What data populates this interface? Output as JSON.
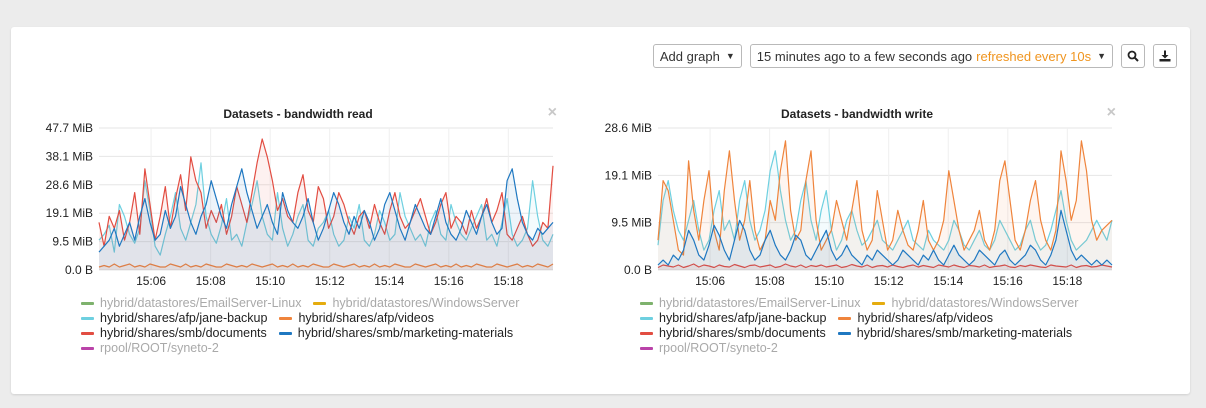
{
  "toolbar": {
    "add_graph_label": "Add graph",
    "time_range_label": "15 minutes ago to a few seconds ago",
    "refresh_label": "refreshed every 10s",
    "zoom_icon": "search-icon",
    "download_icon": "download-icon"
  },
  "chart_data": [
    {
      "type": "area",
      "title": "Datasets - bandwidth read",
      "close_label": "×",
      "y_unit": "MiB",
      "ylim": [
        0,
        47.7
      ],
      "y_ticks": [
        "0.0 B",
        "9.5 MiB",
        "19.1 MiB",
        "28.6 MiB",
        "38.1 MiB",
        "47.7 MiB"
      ],
      "x_ticks": [
        "15:06",
        "15:08",
        "15:10",
        "15:12",
        "15:14",
        "15:16",
        "15:18"
      ],
      "xlim": [
        "15:04:15",
        "15:19:30"
      ],
      "series": [
        {
          "name": "hybrid/datastores/EmailServer-Linux",
          "color": "#7eb26d",
          "hidden": true
        },
        {
          "name": "hybrid/datastores/WindowsServer",
          "color": "#e5ac0e",
          "hidden": true
        },
        {
          "name": "hybrid/shares/afp/jane-backup",
          "color": "#6ed0e0",
          "hidden": false,
          "values": [
            10,
            12,
            15,
            6,
            22,
            18,
            12,
            9,
            14,
            30,
            20,
            8,
            5,
            12,
            18,
            26,
            14,
            10,
            16,
            22,
            36,
            18,
            12,
            9,
            15,
            24,
            10,
            12,
            8,
            16,
            22,
            30,
            18,
            12,
            10,
            26,
            14,
            8,
            12,
            18,
            22,
            10,
            8,
            14,
            16,
            20,
            12,
            8,
            10,
            18,
            14,
            22,
            10,
            8,
            12,
            20,
            16,
            10,
            12,
            26,
            18,
            14,
            10,
            12,
            8,
            16,
            20,
            12,
            10,
            22,
            16,
            12,
            10,
            14,
            18,
            22,
            10,
            12,
            8,
            16,
            24,
            12,
            8,
            10,
            14,
            30,
            18,
            10,
            8,
            12
          ]
        },
        {
          "name": "hybrid/shares/afp/videos",
          "color": "#ef843c",
          "hidden": false,
          "values": [
            1,
            1.5,
            1,
            2,
            1,
            1.5,
            2,
            1,
            1.5,
            1,
            2,
            1.5,
            1,
            1,
            2,
            1.5,
            1,
            2,
            1,
            1.5,
            1,
            2,
            1.5,
            1,
            1,
            2,
            1.5,
            1,
            1.5,
            1,
            2,
            1.5,
            1,
            1.5,
            2,
            1,
            1.5,
            1,
            2,
            1,
            1.5,
            1,
            2,
            1.5,
            1,
            1,
            2,
            1.5,
            1,
            1.5,
            2,
            1,
            1.5,
            1,
            2,
            1,
            1.5,
            1,
            2,
            1.5,
            1,
            1,
            2,
            1.5,
            1,
            1.5,
            2,
            1,
            1.5,
            1,
            2,
            1,
            1.5,
            1,
            2,
            1.5,
            1,
            1,
            2,
            1.5,
            1,
            1.5,
            2,
            1,
            1.5,
            1,
            2,
            1.5,
            1,
            2
          ]
        },
        {
          "name": "hybrid/shares/smb/documents",
          "color": "#e24d42",
          "hidden": false,
          "values": [
            16,
            8,
            18,
            14,
            20,
            10,
            16,
            26,
            12,
            34,
            22,
            10,
            18,
            28,
            14,
            24,
            32,
            20,
            38,
            30,
            26,
            14,
            20,
            16,
            22,
            12,
            18,
            28,
            22,
            16,
            26,
            36,
            44,
            38,
            30,
            20,
            24,
            18,
            16,
            26,
            32,
            20,
            16,
            28,
            24,
            14,
            18,
            26,
            22,
            16,
            12,
            18,
            20,
            14,
            22,
            16,
            12,
            20,
            26,
            18,
            14,
            16,
            20,
            24,
            18,
            12,
            16,
            22,
            26,
            14,
            18,
            16,
            12,
            20,
            14,
            18,
            24,
            16,
            20,
            26,
            12,
            10,
            14,
            18,
            12,
            8,
            10,
            16,
            14,
            35
          ]
        },
        {
          "name": "hybrid/shares/smb/marketing-materials",
          "color": "#1f78c1",
          "hidden": false,
          "values": [
            6,
            8,
            10,
            14,
            8,
            12,
            16,
            10,
            18,
            24,
            16,
            10,
            12,
            20,
            14,
            18,
            28,
            22,
            16,
            12,
            18,
            22,
            30,
            24,
            18,
            14,
            22,
            28,
            34,
            26,
            20,
            14,
            18,
            22,
            16,
            12,
            26,
            20,
            16,
            14,
            18,
            24,
            16,
            10,
            14,
            20,
            26,
            22,
            16,
            12,
            18,
            14,
            20,
            16,
            10,
            14,
            22,
            26,
            20,
            14,
            10,
            16,
            22,
            18,
            14,
            12,
            18,
            24,
            16,
            12,
            10,
            14,
            20,
            16,
            12,
            18,
            22,
            16,
            12,
            14,
            30,
            34,
            24,
            16,
            12,
            10,
            14,
            12,
            14,
            16
          ]
        },
        {
          "name": "rpool/ROOT/syneto-2",
          "color": "#ba43a9",
          "hidden": true
        }
      ]
    },
    {
      "type": "area",
      "title": "Datasets - bandwidth write",
      "close_label": "×",
      "y_unit": "MiB",
      "ylim": [
        0,
        28.6
      ],
      "y_ticks": [
        "0.0 B",
        "9.5 MiB",
        "19.1 MiB",
        "28.6 MiB"
      ],
      "x_ticks": [
        "15:06",
        "15:08",
        "15:10",
        "15:12",
        "15:14",
        "15:16",
        "15:18"
      ],
      "xlim": [
        "15:04:15",
        "15:19:30"
      ],
      "series": [
        {
          "name": "hybrid/datastores/EmailServer-Linux",
          "color": "#7eb26d",
          "hidden": true
        },
        {
          "name": "hybrid/datastores/WindowsServer",
          "color": "#e5ac0e",
          "hidden": true
        },
        {
          "name": "hybrid/shares/afp/jane-backup",
          "color": "#6ed0e0",
          "hidden": false,
          "values": [
            5,
            14,
            18,
            12,
            8,
            6,
            10,
            14,
            8,
            4,
            6,
            12,
            16,
            8,
            10,
            6,
            14,
            18,
            10,
            6,
            8,
            12,
            20,
            24,
            16,
            10,
            6,
            8,
            14,
            18,
            10,
            6,
            12,
            16,
            8,
            4,
            6,
            10,
            12,
            8,
            5,
            6,
            8,
            10,
            6,
            5,
            4,
            6,
            8,
            10,
            6,
            5,
            4,
            8,
            6,
            5,
            4,
            6,
            10,
            8,
            5,
            4,
            6,
            8,
            5,
            4,
            6,
            10,
            8,
            6,
            4,
            5,
            8,
            10,
            6,
            4,
            5,
            8,
            12,
            16,
            10,
            6,
            4,
            5,
            6,
            8,
            10,
            8,
            6,
            10
          ]
        },
        {
          "name": "hybrid/shares/afp/videos",
          "color": "#ef843c",
          "hidden": false,
          "values": [
            6,
            18,
            16,
            10,
            4,
            3,
            22,
            12,
            6,
            14,
            20,
            8,
            4,
            16,
            24,
            14,
            6,
            10,
            18,
            8,
            4,
            6,
            14,
            10,
            20,
            26,
            12,
            6,
            8,
            18,
            24,
            10,
            4,
            6,
            8,
            14,
            10,
            6,
            12,
            18,
            8,
            4,
            6,
            16,
            10,
            4,
            6,
            12,
            8,
            5,
            4,
            8,
            14,
            6,
            4,
            6,
            10,
            20,
            14,
            8,
            4,
            6,
            8,
            12,
            6,
            4,
            8,
            18,
            22,
            14,
            6,
            4,
            8,
            14,
            18,
            10,
            6,
            4,
            8,
            24,
            18,
            10,
            14,
            26,
            20,
            10,
            6,
            8,
            9,
            10
          ]
        },
        {
          "name": "hybrid/shares/smb/documents",
          "color": "#e24d42",
          "hidden": false,
          "values": [
            0.5,
            1,
            0.8,
            0.6,
            1,
            0.5,
            0.8,
            1.2,
            0.6,
            1,
            0.8,
            0.5,
            1,
            0.7,
            0.6,
            1.1,
            0.8,
            0.5,
            0.9,
            1,
            0.6,
            0.8,
            1,
            0.5,
            0.7,
            1.2,
            0.8,
            0.6,
            1,
            0.5,
            0.9,
            0.7,
            1,
            0.6,
            0.8,
            1,
            0.5,
            0.7,
            1.1,
            0.8,
            0.6,
            1,
            0.5,
            0.8,
            0.9,
            0.6,
            1,
            0.7,
            0.5,
            0.8,
            1,
            0.6,
            0.9,
            0.7,
            0.5,
            1,
            0.8,
            0.6,
            1,
            0.7,
            0.5,
            0.9,
            0.8,
            0.6,
            1,
            0.5,
            0.7,
            0.8,
            1,
            0.6,
            0.5,
            0.9,
            0.7,
            1,
            0.8,
            0.6,
            0.5,
            1,
            0.8,
            0.7,
            0.6,
            1,
            0.5,
            0.8,
            0.9,
            0.6,
            0.7,
            1,
            0.8,
            0.6
          ]
        },
        {
          "name": "hybrid/shares/smb/marketing-materials",
          "color": "#1f78c1",
          "hidden": false,
          "values": [
            1,
            2,
            1,
            3,
            2,
            4,
            8,
            6,
            3,
            2,
            5,
            9,
            7,
            4,
            2,
            6,
            10,
            8,
            4,
            2,
            3,
            6,
            8,
            5,
            3,
            2,
            4,
            7,
            6,
            3,
            2,
            4,
            6,
            8,
            4,
            2,
            3,
            5,
            3,
            2,
            1,
            3,
            2,
            4,
            3,
            2,
            1,
            2,
            4,
            3,
            2,
            1,
            3,
            2,
            4,
            2,
            1,
            3,
            5,
            3,
            2,
            1,
            2,
            4,
            3,
            2,
            1,
            3,
            4,
            2,
            1,
            2,
            3,
            5,
            4,
            2,
            1,
            3,
            6,
            12,
            8,
            4,
            2,
            3,
            2,
            1,
            2,
            1,
            2,
            1
          ]
        },
        {
          "name": "rpool/ROOT/syneto-2",
          "color": "#ba43a9",
          "hidden": true
        }
      ]
    }
  ]
}
